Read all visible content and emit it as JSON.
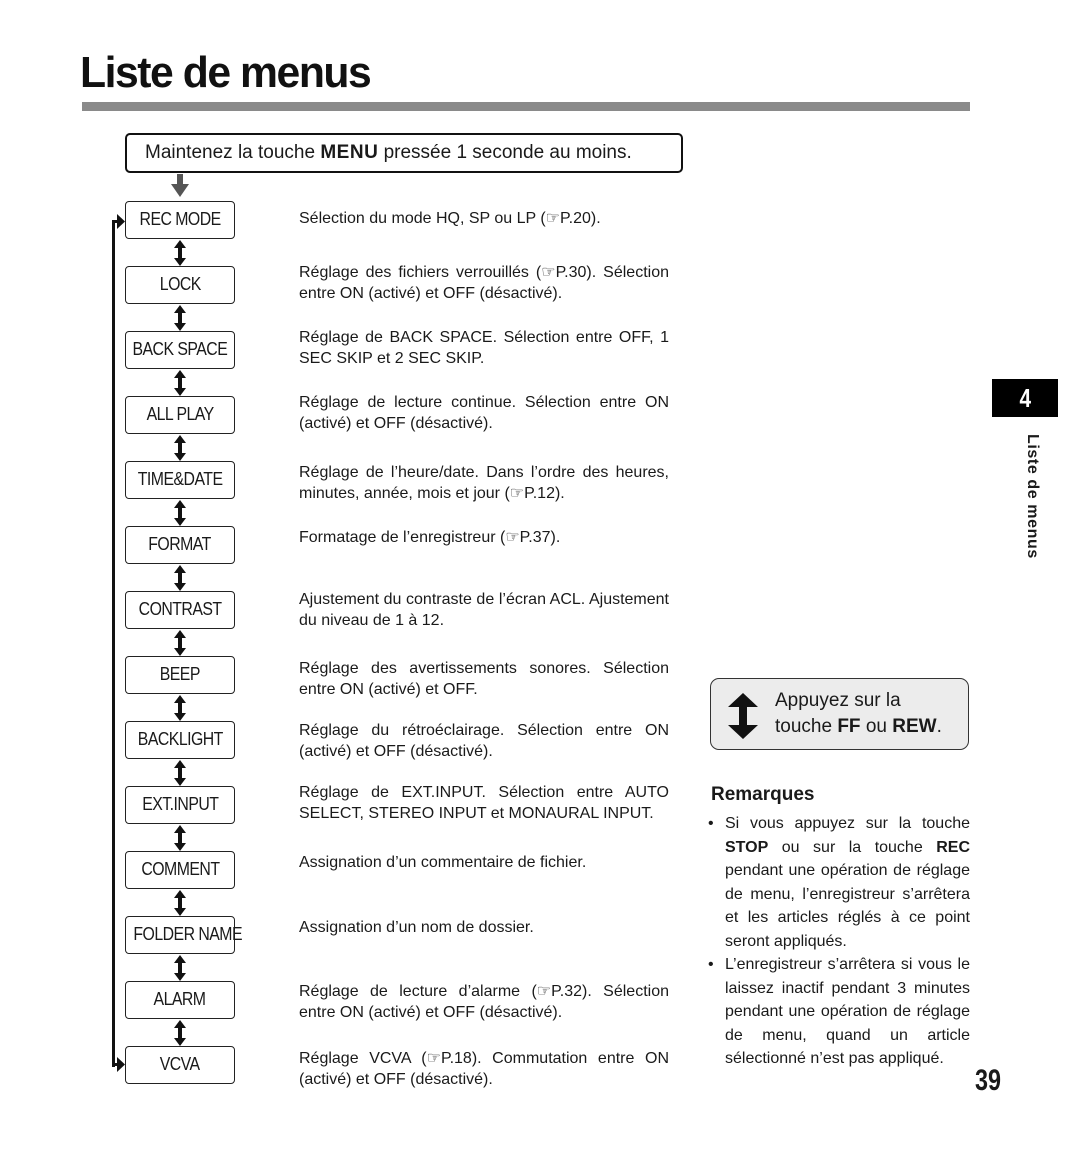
{
  "page": {
    "title": "Liste de menus",
    "page_number": "39",
    "chapter_number": "4",
    "side_label": "Liste de menus"
  },
  "start": {
    "text_before": "Maintenez la touche ",
    "key": "MENU",
    "text_after": " pressée 1 seconde au moins."
  },
  "menu_items": [
    {
      "label": "REC MODE",
      "description": "Sélection du mode HQ, SP ou LP (☞P.20)."
    },
    {
      "label": "LOCK",
      "description": "Réglage des fichiers verrouillés (☞P.30). Sélection entre ON (activé) et OFF (désactivé)."
    },
    {
      "label": "BACK SPACE",
      "description": "Réglage de BACK SPACE. Sélection entre OFF, 1 SEC SKIP et 2 SEC SKIP."
    },
    {
      "label": "ALL PLAY",
      "description": "Réglage de lecture continue. Sélection entre ON (activé) et OFF (désactivé)."
    },
    {
      "label": "TIME&DATE",
      "description": "Réglage de l’heure/date. Dans l’ordre des heures, minutes, année, mois et jour (☞P.12)."
    },
    {
      "label": "FORMAT",
      "description": "Formatage de l’enregistreur (☞P.37)."
    },
    {
      "label": "CONTRAST",
      "description": "Ajustement du contraste de l’écran ACL. Ajustement du niveau de 1 à 12."
    },
    {
      "label": "BEEP",
      "description": "Réglage des avertissements sonores. Sélection entre ON (activé) et OFF."
    },
    {
      "label": "BACKLIGHT",
      "description": "Réglage du rétroéclairage. Sélection entre ON (activé) et OFF (désactivé)."
    },
    {
      "label": "EXT.INPUT",
      "description": "Réglage de EXT.INPUT. Sélection entre AUTO SELECT, STEREO INPUT et MONAURAL INPUT."
    },
    {
      "label": "COMMENT",
      "description": "Assignation d’un commentaire de fichier."
    },
    {
      "label": "FOLDER NAME",
      "description": "Assignation d’un nom de dossier."
    },
    {
      "label": "ALARM",
      "description": "Réglage de lecture d’alarme (☞P.32). Sélection entre ON (activé) et OFF (désactivé)."
    },
    {
      "label": "VCVA",
      "description": "Réglage VCVA (☞P.18). Commutation entre ON (activé) et OFF (désactivé)."
    }
  ],
  "navigation_hint": {
    "line1": "Appuyez sur la",
    "line2_before": "touche ",
    "key1": "FF",
    "middle": " ou ",
    "key2": "REW",
    "end": "."
  },
  "remarks": {
    "heading": "Remarques",
    "items": [
      {
        "before": "Si vous appuyez sur la touche ",
        "key1": "STOP",
        "middle": " ou sur la touche ",
        "key2": "REC",
        "after": " pendant une opération de réglage de menu, l’enregistreur s’arrêtera et les articles réglés à ce point seront appliqués."
      },
      {
        "text": "L’enregistreur s’arrêtera si vous le laissez inactif pendant 3 minutes pendant une opération de réglage de menu, quand un article sélectionné n’est pas appliqué."
      }
    ]
  }
}
